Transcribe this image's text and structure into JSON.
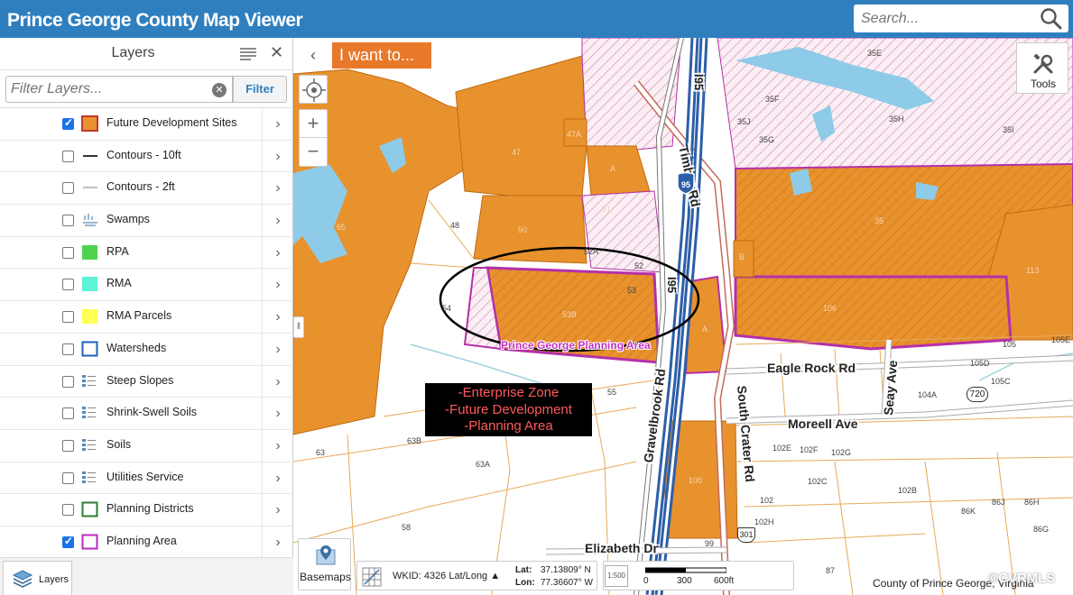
{
  "header": {
    "app_title": "Prince George County Map Viewer",
    "search_placeholder": "Search..."
  },
  "panel": {
    "title": "Layers",
    "filter_placeholder": "Filter Layers...",
    "filter_button": "Filter",
    "layers": [
      {
        "label": "Future Development Sites",
        "checked": true,
        "symbol": "orange-square"
      },
      {
        "label": "Contours - 10ft",
        "checked": false,
        "symbol": "dark-line"
      },
      {
        "label": "Contours - 2ft",
        "checked": false,
        "symbol": "light-line"
      },
      {
        "label": "Swamps",
        "checked": false,
        "symbol": "swamp-icon"
      },
      {
        "label": "RPA",
        "checked": false,
        "symbol": "green-square"
      },
      {
        "label": "RMA",
        "checked": false,
        "symbol": "aqua-square"
      },
      {
        "label": "RMA Parcels",
        "checked": false,
        "symbol": "yellow-square"
      },
      {
        "label": "Watersheds",
        "checked": false,
        "symbol": "blue-outline-square"
      },
      {
        "label": "Steep Slopes",
        "checked": false,
        "symbol": "legend-list-icon"
      },
      {
        "label": "Shrink-Swell Soils",
        "checked": false,
        "symbol": "legend-list-icon"
      },
      {
        "label": "Soils",
        "checked": false,
        "symbol": "legend-list-icon"
      },
      {
        "label": "Utilities Service",
        "checked": false,
        "symbol": "legend-list-icon"
      },
      {
        "label": "Planning Districts",
        "checked": false,
        "symbol": "green-outline-square"
      },
      {
        "label": "Planning Area",
        "checked": true,
        "symbol": "magenta-outline-square"
      }
    ],
    "footer_tab": "Layers"
  },
  "map": {
    "i_want_to": "I want to...",
    "tools_label": "Tools",
    "annotation_lines": [
      "-Enterprise Zone",
      "-Future Development",
      "-Planning Area"
    ],
    "planning_area_label": "Prince George Planning Area",
    "roads": {
      "timber": "Timber Rd",
      "i95": "I95",
      "i95_left": "I95",
      "gravelbrook": "Gravelbrook Rd",
      "south_crater": "South Crater Rd",
      "eagle_rock": "Eagle Rock Rd",
      "seay": "Seay Ave",
      "moreell": "Moreell Ave",
      "elizabeth": "Elizabeth Dr"
    },
    "shields": {
      "interstate": "95",
      "route720": "720",
      "route301": "301"
    },
    "parcels": [
      "35E",
      "35F",
      "35J",
      "35G",
      "35H",
      "35I",
      "47A",
      "47",
      "65",
      "48",
      "50",
      "51",
      "52A",
      "52",
      "53",
      "53B",
      "54",
      "A",
      "B",
      "35",
      "113",
      "106",
      "105",
      "105D",
      "105E",
      "105C",
      "104A",
      "55",
      "63",
      "63B",
      "63A",
      "58",
      "100",
      "102",
      "102E",
      "102F",
      "102G",
      "102C",
      "102B",
      "102H",
      "86J",
      "86H",
      "86K",
      "86G",
      "99",
      "87"
    ],
    "basemaps_label": "Basemaps",
    "wkid_label": "WKID: 4326 Lat/Long ▲",
    "lat_label": "Lat:",
    "lat_value": "37.13809° N",
    "lon_label": "Lon:",
    "lon_value": "77.36607° W",
    "scale_labels": [
      "0",
      "300",
      "600ft"
    ],
    "copyright": "County of Prince George, Virginia",
    "watermark": "©CVRMLS"
  },
  "colors": {
    "header": "#2f7fbf",
    "development_orange": "#e8922e",
    "planning_magenta": "#b530a8",
    "water": "#8dcbe8",
    "annotation_text": "#ff5a5a"
  }
}
